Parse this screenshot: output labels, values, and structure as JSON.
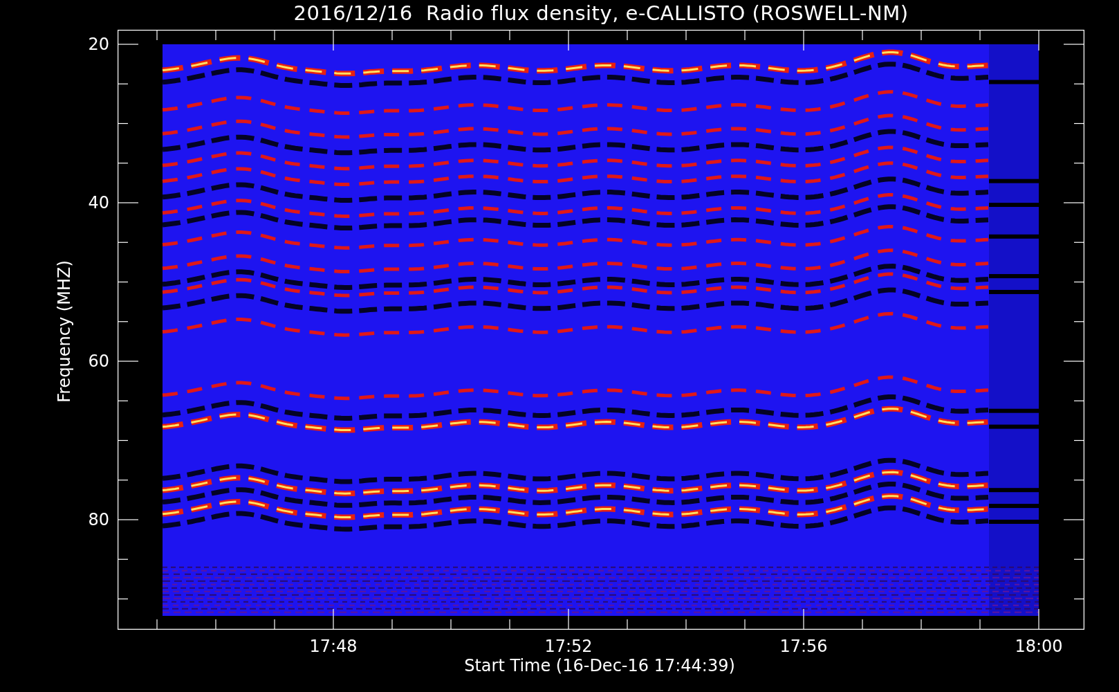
{
  "title": "2016/12/16  Radio flux density, e-CALLISTO (ROSWELL-NM)",
  "y_axis": {
    "label": "Frequency (MHZ)",
    "ticks": [
      "20",
      "40",
      "60",
      "80"
    ]
  },
  "x_axis": {
    "label": "Start Time (16-Dec-16 17:44:39)",
    "ticks": [
      "17:48",
      "17:52",
      "17:56",
      "18:00"
    ]
  }
}
